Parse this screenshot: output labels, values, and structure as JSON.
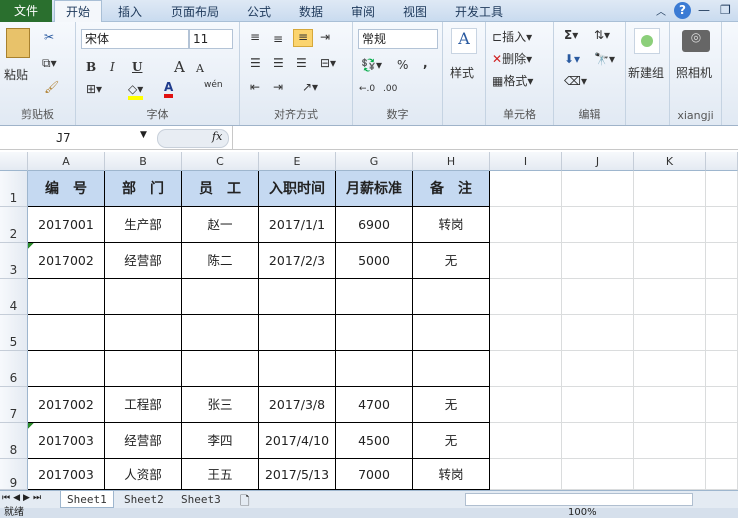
{
  "tabs": [
    "文件",
    "开始",
    "插入",
    "页面布局",
    "公式",
    "数据",
    "审阅",
    "视图",
    "开发工具"
  ],
  "ribbon": {
    "clipboard": {
      "paste": "粘贴",
      "label": "剪贴板"
    },
    "font": {
      "name": "宋体",
      "size": "11",
      "bold": "B",
      "italic": "I",
      "underline": "U",
      "grow": "A",
      "shrink": "A",
      "phonetic": "wén",
      "label": "字体"
    },
    "align": {
      "label": "对齐方式"
    },
    "number": {
      "format": "常规",
      "percent": "%",
      "comma": ",",
      "inc": "←.0",
      "dec": ".00",
      "label": "数字"
    },
    "styles": {
      "label": "样式"
    },
    "cells": {
      "insert": "插入",
      "delete": "删除",
      "format": "格式",
      "label": "单元格"
    },
    "editing": {
      "sum": "Σ",
      "label": "编辑"
    },
    "newgroup": {
      "label": "新建组"
    },
    "camera": {
      "button": "照相机",
      "label": "xiangji"
    }
  },
  "formula_bar": {
    "name_box": "J7",
    "fx": "fx",
    "value": ""
  },
  "columns": [
    "A",
    "B",
    "C",
    "E",
    "G",
    "H",
    "I",
    "J",
    "K"
  ],
  "rows": [
    "1",
    "2",
    "3",
    "4",
    "5",
    "6",
    "7",
    "8",
    "9"
  ],
  "table": {
    "headers": [
      "编　号",
      "部　门",
      "员　工",
      "入职时间",
      "月薪标准",
      "备　注"
    ],
    "rows": [
      [
        "2017001",
        "生产部",
        "赵一",
        "2017/1/1",
        "6900",
        "转岗"
      ],
      [
        "2017002",
        "经营部",
        "陈二",
        "2017/2/3",
        "5000",
        "无"
      ],
      [
        "",
        "",
        "",
        "",
        "",
        ""
      ],
      [
        "",
        "",
        "",
        "",
        "",
        ""
      ],
      [
        "",
        "",
        "",
        "",
        "",
        ""
      ],
      [
        "2017002",
        "工程部",
        "张三",
        "2017/3/8",
        "4700",
        "无"
      ],
      [
        "2017003",
        "经营部",
        "李四",
        "2017/4/10",
        "4500",
        "无"
      ],
      [
        "2017003",
        "人资部",
        "王五",
        "2017/5/13",
        "7000",
        "转岗"
      ]
    ]
  },
  "sheets": [
    "Sheet1",
    "Sheet2",
    "Sheet3"
  ],
  "status": {
    "ready": "就绪",
    "zoom": "100%"
  }
}
